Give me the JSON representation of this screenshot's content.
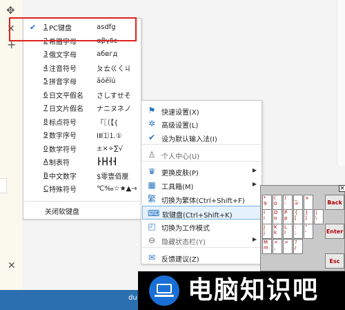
{
  "background": {
    "move_icon": "move-icon",
    "close_icon": "close-icon",
    "plus_icon": "plus-icon",
    "taskbar_text": "du"
  },
  "soft_keyboard_menu": {
    "items": [
      {
        "num": "1",
        "name": "PC键盘",
        "sample": "asdfg",
        "checked": true
      },
      {
        "num": "2",
        "name": "希腊字母",
        "sample": "αβγδε",
        "checked": false
      },
      {
        "num": "3",
        "name": "俄文字母",
        "sample": "абвгд",
        "checked": false
      },
      {
        "num": "4",
        "name": "注音符号",
        "sample": "ㄆㄊㄍㄑㄐ",
        "checked": false
      },
      {
        "num": "5",
        "name": "拼音字母",
        "sample": "āóěīú",
        "checked": false
      },
      {
        "num": "6",
        "name": "日文平假名",
        "sample": "さしすせそ",
        "checked": false
      },
      {
        "num": "7",
        "name": "日文片假名",
        "sample": "ナニヌネノ",
        "checked": false
      },
      {
        "num": "8",
        "name": "标点符号",
        "sample": "『〖〔【{",
        "checked": false
      },
      {
        "num": "9",
        "name": "数字序号",
        "sample": "ⅠⅡ⑴⒈①",
        "checked": false
      },
      {
        "num": "0",
        "name": "数学符号",
        "sample": "±×÷∑√",
        "checked": false
      },
      {
        "num": "A",
        "name": "制表符",
        "sample": "┣┣┫┫┫",
        "checked": false
      },
      {
        "num": "B",
        "name": "中文数字",
        "sample": "$零壹佰厘",
        "checked": false
      },
      {
        "num": "C",
        "name": "特殊符号",
        "sample": "℃‰☆★▲→",
        "checked": false
      }
    ],
    "close_label": "关闭软键盘"
  },
  "ime_menu": {
    "items": [
      {
        "icon": "flag-icon",
        "glyph": "⚑",
        "label": "快速设置(X)",
        "arrow": false,
        "selected": false,
        "grey": false
      },
      {
        "icon": "gear-icon",
        "glyph": "✲",
        "label": "高级设置(L)",
        "arrow": false,
        "selected": false,
        "grey": false
      },
      {
        "icon": "check-circle-icon",
        "glyph": "✔",
        "label": "设为默认输入法(I)",
        "arrow": false,
        "selected": false,
        "grey": false
      },
      {
        "icon": "user-icon",
        "glyph": "♙",
        "label": "个人中心(U)",
        "arrow": false,
        "selected": false,
        "grey": true
      },
      {
        "icon": "shirt-icon",
        "glyph": "♛",
        "label": "更换皮肤(P)",
        "arrow": true,
        "selected": false,
        "grey": false
      },
      {
        "icon": "grid-icon",
        "glyph": "▦",
        "label": "工具箱(M)",
        "arrow": true,
        "selected": false,
        "grey": false
      },
      {
        "icon": "traditional-icon",
        "glyph": "繁",
        "label": "切换为繁体(Ctrl+Shift+F)",
        "arrow": false,
        "selected": false,
        "grey": false
      },
      {
        "icon": "keyboard-icon",
        "glyph": "⌨",
        "label": "软键盘(Ctrl+Shift+K)",
        "arrow": false,
        "selected": true,
        "grey": false
      },
      {
        "icon": "work-mode-icon",
        "glyph": "◰",
        "label": "切换为工作模式",
        "arrow": false,
        "selected": false,
        "grey": false
      },
      {
        "icon": "minus-circle-icon",
        "glyph": "⊖",
        "label": "隐藏状态栏(Y)",
        "arrow": true,
        "selected": false,
        "grey": true
      },
      {
        "icon": "feedback-icon",
        "glyph": "✉",
        "label": "反馈建议(Z)",
        "arrow": false,
        "selected": false,
        "grey": false
      }
    ]
  },
  "soft_keyboard": {
    "close_label": "×",
    "backspace_label": "Back",
    "enter_label": "Enter",
    "esc_label": "Esc",
    "rows": [
      [
        {
          "top": "*",
          "bot": "9"
        },
        {
          "top": "(",
          "bot": "0"
        },
        {
          "top": ")",
          "bot": "-"
        },
        {
          "top": "_",
          "bot": "="
        },
        {
          "top": "+",
          "bot": ""
        }
      ],
      [
        {
          "top": "I",
          "bot": "i"
        },
        {
          "top": "O",
          "bot": "o"
        },
        {
          "top": "P",
          "bot": "p"
        },
        {
          "top": "{",
          "bot": "["
        },
        {
          "top": "}",
          "bot": "]"
        },
        {
          "top": "|",
          "bot": "\\"
        }
      ],
      [
        {
          "top": "J",
          "bot": "j"
        },
        {
          "top": "K",
          "bot": "k"
        },
        {
          "top": "L",
          "bot": "l"
        },
        {
          "top": ":",
          "bot": ";"
        },
        {
          "top": "\"",
          "bot": "'"
        }
      ],
      [
        {
          "top": "M",
          "bot": "m"
        },
        {
          "top": "<",
          "bot": ","
        },
        {
          "top": ">",
          "bot": "."
        },
        {
          "top": "?",
          "bot": "/"
        }
      ]
    ]
  },
  "watermark": {
    "logo_icon": "laptop-logo-icon",
    "text": "电脑知识吧"
  }
}
